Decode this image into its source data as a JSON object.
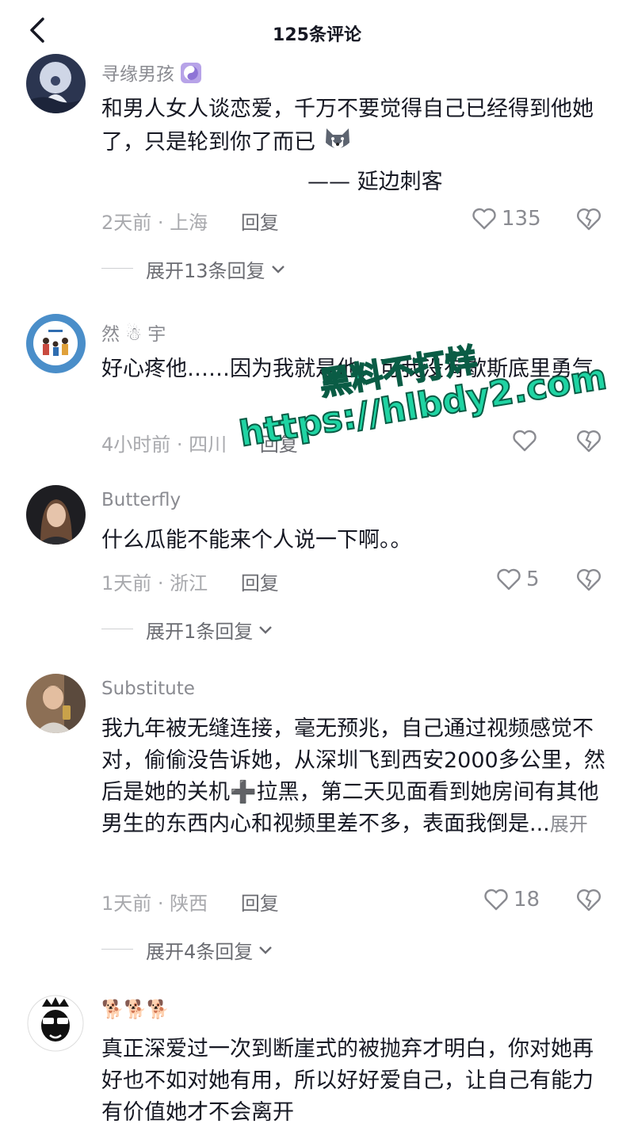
{
  "header": {
    "title": "125条评论"
  },
  "comments": [
    {
      "username": "寻缘男孩",
      "text": "和男人女人谈恋爱，千万不要觉得自己已经得到他她了，只是轮到你了而已",
      "signature": "—— 延边刺客",
      "time": "2天前",
      "location": "上海",
      "reply": "回复",
      "likes": "135",
      "expand": "展开13条回复",
      "avatar_icon": "moon-figure-avatar",
      "badge_icon": "yin-yang-icon",
      "emoji_icon": "husky-dog-emoji"
    },
    {
      "username": "然 ☃ 宇",
      "text": "好心疼他……因为我就是他，可我没有歇斯底里勇气",
      "time": "4小时前",
      "location": "四川",
      "reply": "回复",
      "likes": "",
      "avatar_icon": "family-cartoon-avatar"
    },
    {
      "username": "Butterfly",
      "text": "什么瓜能不能来个人说一下啊。。",
      "time": "1天前",
      "location": "浙江",
      "reply": "回复",
      "likes": "5",
      "expand": "展开1条回复",
      "avatar_icon": "woman-portrait-avatar"
    },
    {
      "username": "Substitute",
      "text": "我九年被无缝连接，毫无预兆，自己通过视频感觉不对，偷偷没告诉她，从深圳飞到西安2000多公里，然后是她的关机➕拉黑，第二天见面看到她房间有其他男生的东西内心和视频里差不多，表面我倒是...",
      "more": "展开",
      "time": "1天前",
      "location": "陕西",
      "reply": "回复",
      "likes": "18",
      "expand": "展开4条回复",
      "avatar_icon": "man-selfie-avatar"
    },
    {
      "username": "🐕🐕🐕",
      "text": "真正深爱过一次到断崖式的被抛弃才明白，你对她再好也不如对她有用，所以好好爱自己，让自己有能力有价值她才不会离开",
      "avatar_icon": "sunglasses-cartoon-avatar"
    }
  ],
  "watermark": {
    "line1": "黑料不打烊",
    "line2": "https://hlbdy2.com"
  },
  "colors": {
    "text_primary": "#161823",
    "text_secondary": "#8a8b91",
    "watermark": "#1fd4a3"
  }
}
